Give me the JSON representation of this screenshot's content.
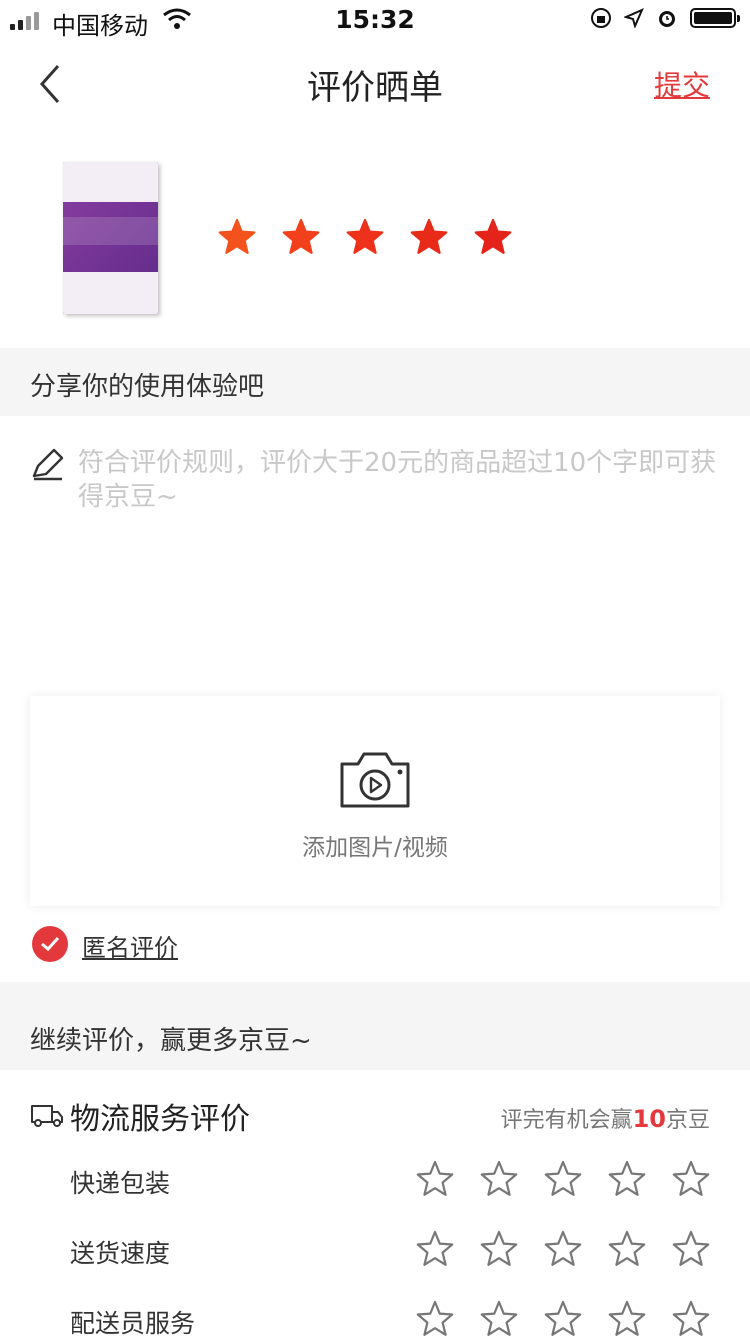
{
  "status_bar": {
    "carrier": "中国移动",
    "time": "15:32"
  },
  "nav": {
    "title": "评价晒单",
    "submit_label": "提交"
  },
  "product": {
    "rating": 5,
    "star_colors": [
      "#f4521c",
      "#f2401c",
      "#ee311a",
      "#e82a18",
      "#e4231a"
    ]
  },
  "share": {
    "heading": "分享你的使用体验吧",
    "placeholder": "符合评价规则，评价大于20元的商品超过10个字即可获得京豆~"
  },
  "upload": {
    "label": "添加图片/视频"
  },
  "anonymous": {
    "label": "匿名评价",
    "checked": true
  },
  "continue": {
    "heading": "继续评价，赢更多京豆~"
  },
  "logistics": {
    "title": "物流服务评价",
    "note_prefix": "评完有机会赢",
    "note_highlight": "10",
    "note_suffix": "京豆",
    "rows": [
      {
        "label": "快递包装",
        "rating": 0
      },
      {
        "label": "送货速度",
        "rating": 0
      },
      {
        "label": "配送员服务",
        "rating": 0
      }
    ]
  },
  "colors": {
    "accent": "#e4393c",
    "section_bg": "#f5f5f5"
  }
}
